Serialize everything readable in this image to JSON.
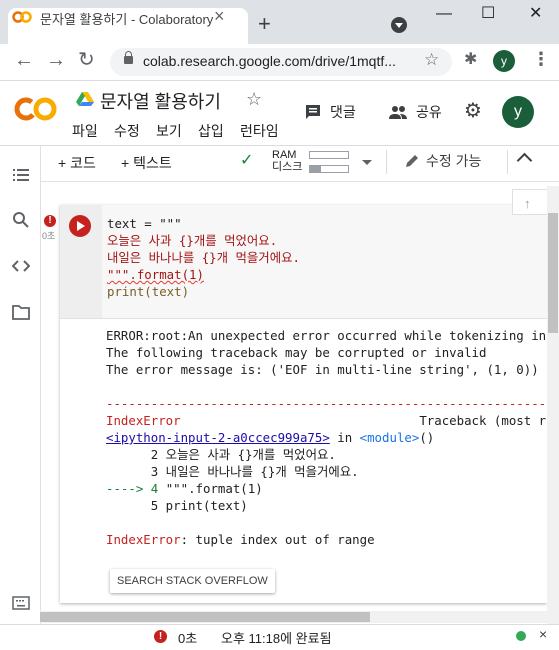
{
  "browser": {
    "tab_title": "문자열 활용하기 - Colaboratory",
    "tab_close": "×",
    "new_tab": "+",
    "window_controls": {
      "minimize": "—",
      "maximize": "☐",
      "close": "✕"
    },
    "url": "colab.research.google.com/drive/1mqtf...",
    "profile_initial": "y"
  },
  "colab": {
    "logo_text": "CO",
    "doc_title": "문자열 활용하기",
    "menu": [
      "파일",
      "수정",
      "보기",
      "삽입",
      "런타임"
    ],
    "comment_label": "댓글",
    "share_label": "공유",
    "profile_initial": "y"
  },
  "notebook_toolbar": {
    "add_code": "+ 코드",
    "add_text": "+ 텍스트",
    "ram_label": "RAM",
    "disk_label": "디스크",
    "ram_level": 0.0,
    "disk_level": 0.3,
    "edit_mode": "수정 가능"
  },
  "cell": {
    "status_mark": "!",
    "exec_time": "0초",
    "code_lines": [
      "text = \"\"\"",
      "오늘은 사과 {}개를 먹었어요.",
      "내일은 바나나를 {}개 먹을거에요.",
      "\"\"\".format(1)",
      "print(text)"
    ],
    "output": {
      "error_line1": "ERROR:root:An unexpected error occurred while tokenizing input",
      "error_line2": "The following traceback may be corrupted or invalid",
      "error_line3": "The error message is: ('EOF in multi-line string', (1, 0))",
      "separator": "---------------------------------------------------------------------------",
      "exc_name": "IndexError",
      "traceback_header": "Traceback (most recent call last)",
      "input_link": "<ipython-input-2-a0ccec999a75>",
      "in_word": " in ",
      "module": "<module>",
      "module_paren": "()",
      "tb_line2": "      2 오늘은 사과 {}개를 먹었어요.",
      "tb_line3": "      3 내일은 바나나를 {}개 먹을거에요.",
      "tb_arrow": "----> 4 ",
      "tb_line4_code": "\"\"\".format(1)",
      "tb_line5": "      5 print(text)",
      "final_exc": "IndexError",
      "final_msg": ": tuple index out of range"
    },
    "so_button": "SEARCH STACK OVERFLOW"
  },
  "statusbar": {
    "error_mark": "!",
    "time": "0초",
    "completed": "오후 11:18에 완료됨",
    "close": "×"
  }
}
